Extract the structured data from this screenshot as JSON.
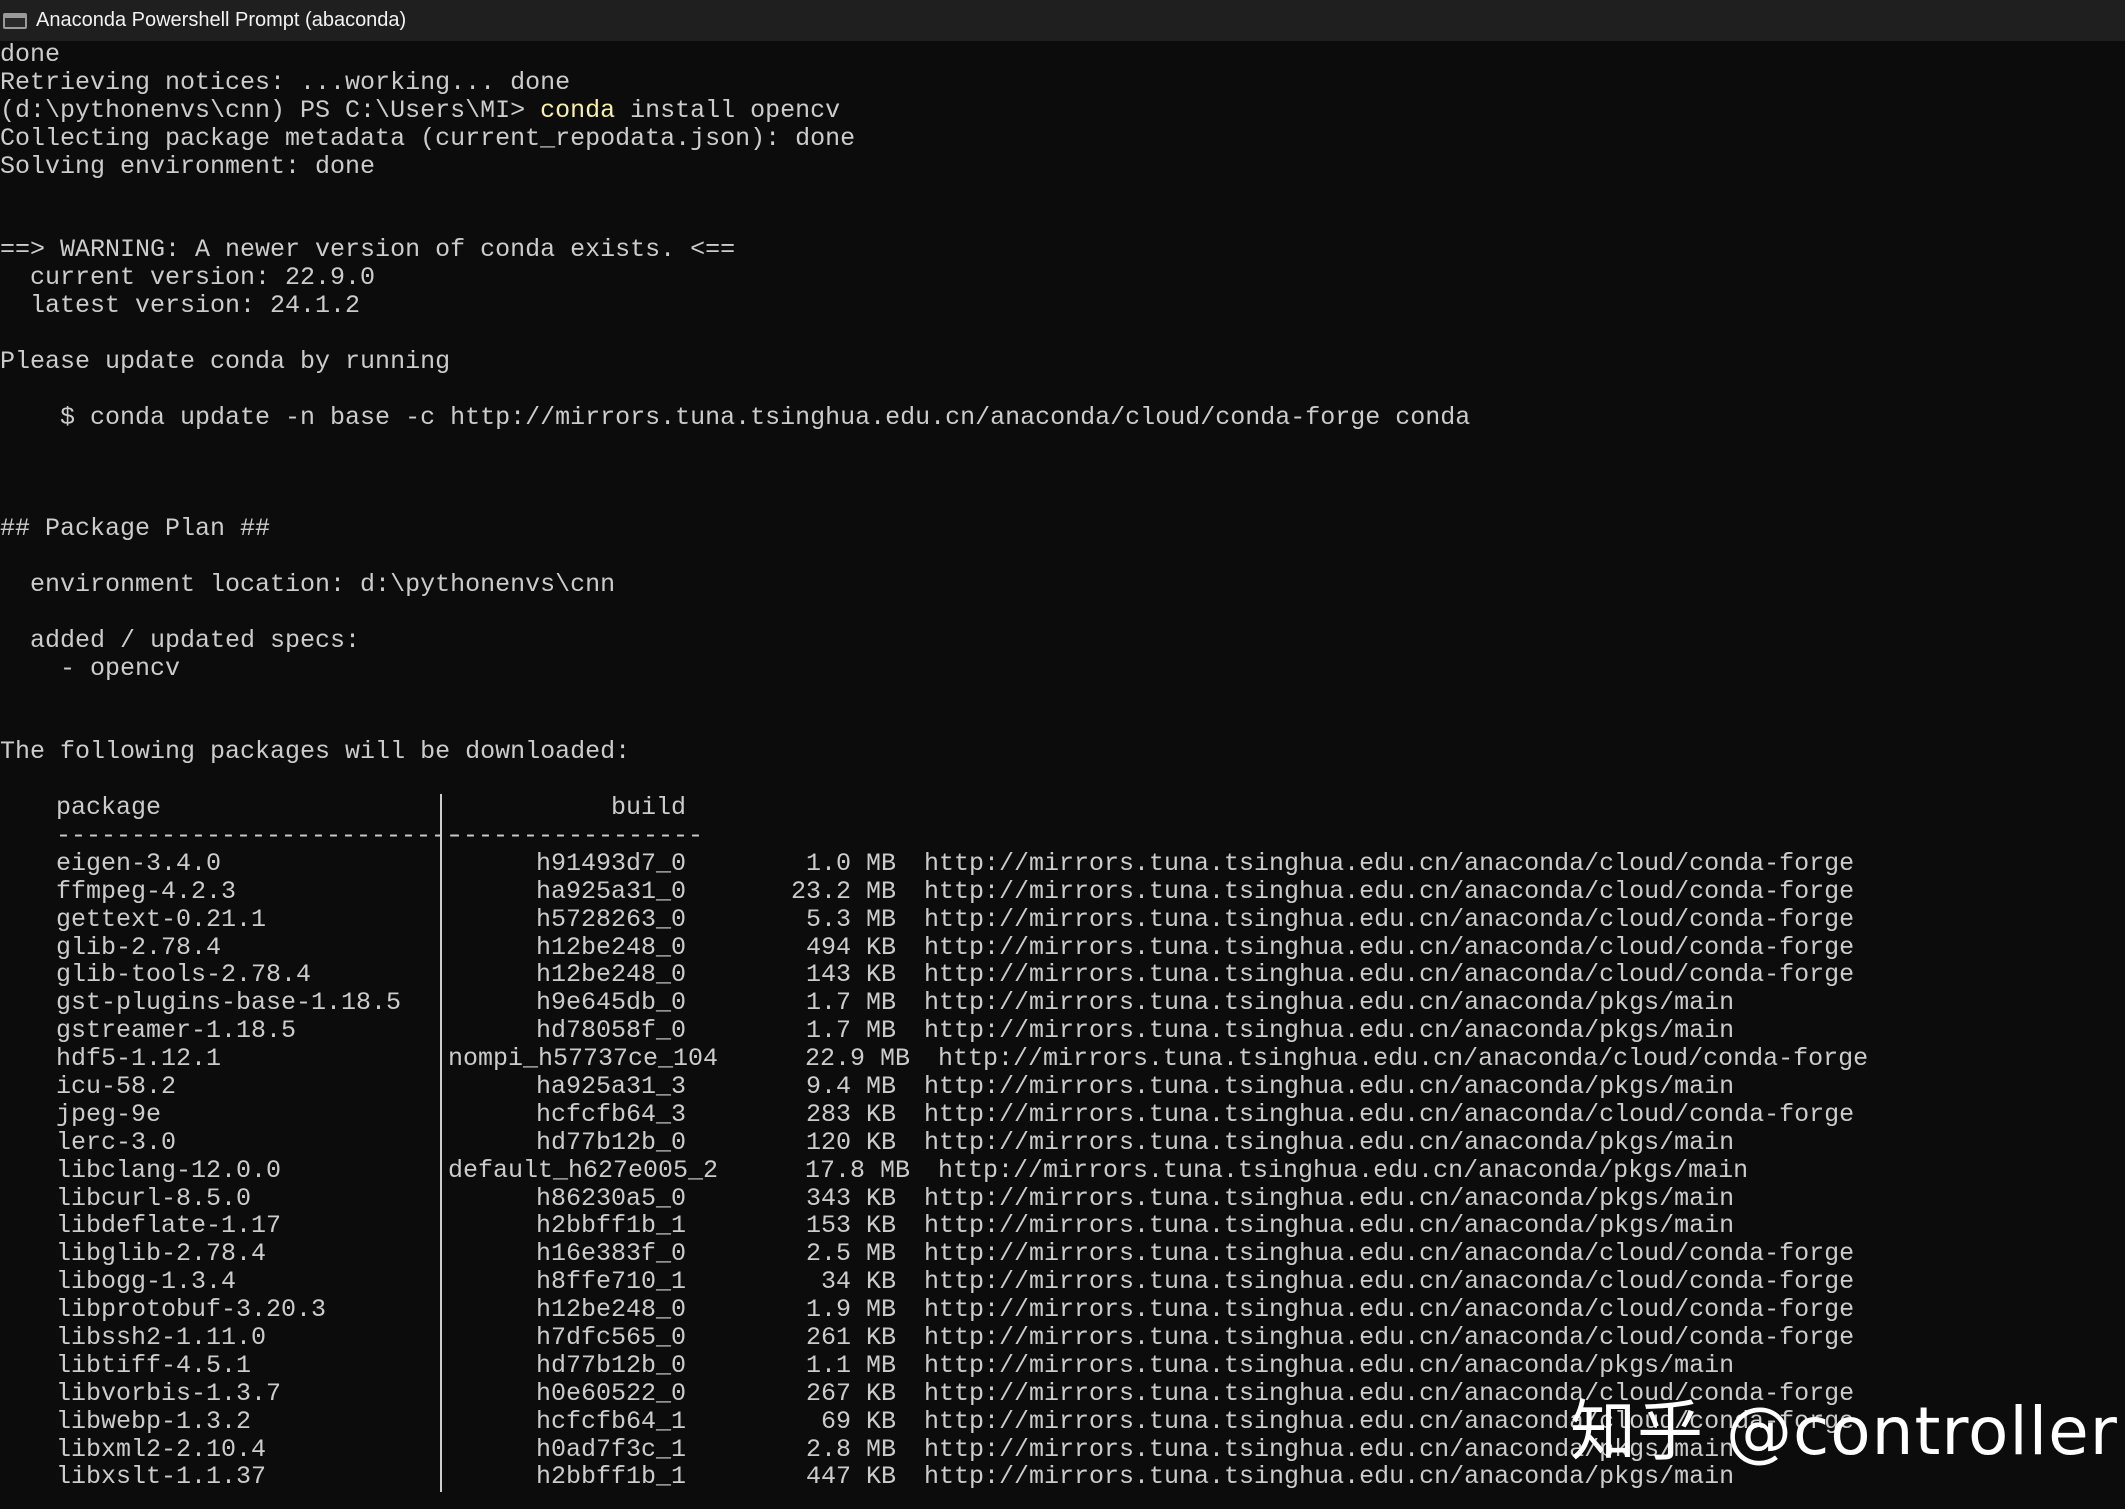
{
  "window": {
    "title": "Anaconda Powershell Prompt (abaconda)"
  },
  "console": {
    "lines": [
      {
        "text": "done"
      },
      {
        "text": "Retrieving notices: ...working... done"
      },
      {
        "prompt": "(d:\\pythonenvs\\cnn) PS C:\\Users\\MI> ",
        "command": "conda",
        "args": " install opencv"
      },
      {
        "text": "Collecting package metadata (current_repodata.json): done"
      },
      {
        "text": "Solving environment: done"
      },
      {
        "text": ""
      },
      {
        "text": ""
      },
      {
        "text": "==> WARNING: A newer version of conda exists. <=="
      },
      {
        "text": "  current version: 22.9.0"
      },
      {
        "text": "  latest version: 24.1.2"
      },
      {
        "text": ""
      },
      {
        "text": "Please update conda by running"
      },
      {
        "text": ""
      },
      {
        "text": "    $ conda update -n base -c http://mirrors.tuna.tsinghua.edu.cn/anaconda/cloud/conda-forge conda"
      },
      {
        "text": ""
      },
      {
        "text": ""
      },
      {
        "text": ""
      },
      {
        "text": "## Package Plan ##"
      },
      {
        "text": ""
      },
      {
        "text": "  environment location: d:\\pythonenvs\\cnn"
      },
      {
        "text": ""
      },
      {
        "text": "  added / updated specs:"
      },
      {
        "text": "    - opencv"
      },
      {
        "text": ""
      },
      {
        "text": ""
      },
      {
        "text": "The following packages will be downloaded:"
      },
      {
        "text": ""
      }
    ]
  },
  "packages": {
    "headers": {
      "package": "package",
      "build": "build"
    },
    "separator_left": "---------------------------",
    "separator_right": "-----------------",
    "rows": [
      {
        "package": "eigen-3.4.0",
        "build": "h91493d7_0",
        "size": "1.0 MB",
        "channel": "http://mirrors.tuna.tsinghua.edu.cn/anaconda/cloud/conda-forge"
      },
      {
        "package": "ffmpeg-4.2.3",
        "build": "ha925a31_0",
        "size": "23.2 MB",
        "channel": "http://mirrors.tuna.tsinghua.edu.cn/anaconda/cloud/conda-forge"
      },
      {
        "package": "gettext-0.21.1",
        "build": "h5728263_0",
        "size": "5.3 MB",
        "channel": "http://mirrors.tuna.tsinghua.edu.cn/anaconda/cloud/conda-forge"
      },
      {
        "package": "glib-2.78.4",
        "build": "h12be248_0",
        "size": "494 KB",
        "channel": "http://mirrors.tuna.tsinghua.edu.cn/anaconda/cloud/conda-forge"
      },
      {
        "package": "glib-tools-2.78.4",
        "build": "h12be248_0",
        "size": "143 KB",
        "channel": "http://mirrors.tuna.tsinghua.edu.cn/anaconda/cloud/conda-forge"
      },
      {
        "package": "gst-plugins-base-1.18.5",
        "build": "h9e645db_0",
        "size": "1.7 MB",
        "channel": "http://mirrors.tuna.tsinghua.edu.cn/anaconda/pkgs/main"
      },
      {
        "package": "gstreamer-1.18.5",
        "build": "hd78058f_0",
        "size": "1.7 MB",
        "channel": "http://mirrors.tuna.tsinghua.edu.cn/anaconda/pkgs/main"
      },
      {
        "package": "hdf5-1.12.1",
        "build": "nompi_h57737ce_104",
        "size": "22.9 MB",
        "channel": "http://mirrors.tuna.tsinghua.edu.cn/anaconda/cloud/conda-forge",
        "wide": true
      },
      {
        "package": "icu-58.2",
        "build": "ha925a31_3",
        "size": "9.4 MB",
        "channel": "http://mirrors.tuna.tsinghua.edu.cn/anaconda/pkgs/main"
      },
      {
        "package": "jpeg-9e",
        "build": "hcfcfb64_3",
        "size": "283 KB",
        "channel": "http://mirrors.tuna.tsinghua.edu.cn/anaconda/cloud/conda-forge"
      },
      {
        "package": "lerc-3.0",
        "build": "hd77b12b_0",
        "size": "120 KB",
        "channel": "http://mirrors.tuna.tsinghua.edu.cn/anaconda/pkgs/main"
      },
      {
        "package": "libclang-12.0.0",
        "build": "default_h627e005_2",
        "size": "17.8 MB",
        "channel": "http://mirrors.tuna.tsinghua.edu.cn/anaconda/pkgs/main",
        "wide": true
      },
      {
        "package": "libcurl-8.5.0",
        "build": "h86230a5_0",
        "size": "343 KB",
        "channel": "http://mirrors.tuna.tsinghua.edu.cn/anaconda/pkgs/main"
      },
      {
        "package": "libdeflate-1.17",
        "build": "h2bbff1b_1",
        "size": "153 KB",
        "channel": "http://mirrors.tuna.tsinghua.edu.cn/anaconda/pkgs/main"
      },
      {
        "package": "libglib-2.78.4",
        "build": "h16e383f_0",
        "size": "2.5 MB",
        "channel": "http://mirrors.tuna.tsinghua.edu.cn/anaconda/cloud/conda-forge"
      },
      {
        "package": "libogg-1.3.4",
        "build": "h8ffe710_1",
        "size": "34 KB",
        "channel": "http://mirrors.tuna.tsinghua.edu.cn/anaconda/cloud/conda-forge"
      },
      {
        "package": "libprotobuf-3.20.3",
        "build": "h12be248_0",
        "size": "1.9 MB",
        "channel": "http://mirrors.tuna.tsinghua.edu.cn/anaconda/cloud/conda-forge"
      },
      {
        "package": "libssh2-1.11.0",
        "build": "h7dfc565_0",
        "size": "261 KB",
        "channel": "http://mirrors.tuna.tsinghua.edu.cn/anaconda/cloud/conda-forge"
      },
      {
        "package": "libtiff-4.5.1",
        "build": "hd77b12b_0",
        "size": "1.1 MB",
        "channel": "http://mirrors.tuna.tsinghua.edu.cn/anaconda/pkgs/main"
      },
      {
        "package": "libvorbis-1.3.7",
        "build": "h0e60522_0",
        "size": "267 KB",
        "channel": "http://mirrors.tuna.tsinghua.edu.cn/anaconda/cloud/conda-forge"
      },
      {
        "package": "libwebp-1.3.2",
        "build": "hcfcfb64_1",
        "size": "69 KB",
        "channel": "http://mirrors.tuna.tsinghua.edu.cn/anaconda/cloud/conda-forge"
      },
      {
        "package": "libxml2-2.10.4",
        "build": "h0ad7f3c_1",
        "size": "2.8 MB",
        "channel": "http://mirrors.tuna.tsinghua.edu.cn/anaconda/pkgs/main"
      },
      {
        "package": "libxslt-1.1.37",
        "build": "h2bbff1b_1",
        "size": "447 KB",
        "channel": "http://mirrors.tuna.tsinghua.edu.cn/anaconda/pkgs/main"
      }
    ]
  },
  "watermark": {
    "text": "知乎 @controller"
  },
  "colors": {
    "background": "#0c0c0c",
    "titlebar": "#1f1f1f",
    "text": "#cccccc",
    "command": "#f9f1a5"
  }
}
